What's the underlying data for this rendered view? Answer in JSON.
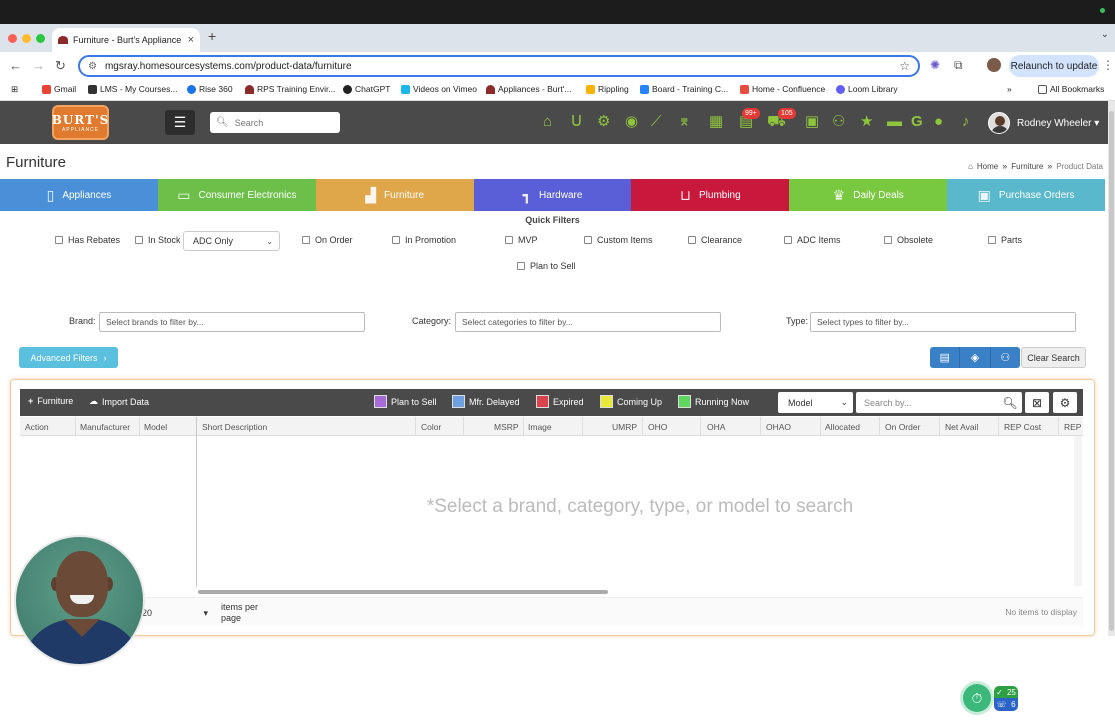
{
  "browser": {
    "tab_title": "Furniture - Burt's Appliance S",
    "new_tab": "+",
    "url": "mgsray.homesourcesystems.com/product-data/furniture",
    "relaunch": "Relaunch to update",
    "bookmarks": [
      {
        "label": "Gmail",
        "color": "#ea4335"
      },
      {
        "label": "LMS - My Courses...",
        "color": "#333333"
      },
      {
        "label": "Rise 360",
        "color": "#1a73e8"
      },
      {
        "label": "RPS Training Envir...",
        "color": "#8a2a2a"
      },
      {
        "label": "ChatGPT",
        "color": "#222222"
      },
      {
        "label": "Videos on Vimeo",
        "color": "#1ab7ea"
      },
      {
        "label": "Appliances - Burt'...",
        "color": "#8a2a2a"
      },
      {
        "label": "Rippling",
        "color": "#f5b400"
      },
      {
        "label": "Board - Training C...",
        "color": "#2684ff"
      },
      {
        "label": "Home - Confluence",
        "color": "#e84c3d"
      },
      {
        "label": "Loom Library",
        "color": "#625df5"
      }
    ],
    "all_bookmarks": "All Bookmarks"
  },
  "header": {
    "logo_line1": "BURT'S",
    "logo_line2": "APPLIANCE",
    "search_placeholder": "Search",
    "badge_notes": "99+",
    "badge_cart": "105",
    "user_name": "Rodney Wheeler"
  },
  "page": {
    "title": "Furniture",
    "breadcrumb": [
      "Home",
      "Furniture",
      "Product Data"
    ]
  },
  "categories": [
    {
      "label": "Appliances",
      "color": "#4a90d9",
      "icon": "fridge-icon"
    },
    {
      "label": "Consumer Electronics",
      "color": "#6cc04a",
      "icon": "tv-icon"
    },
    {
      "label": "Furniture",
      "color": "#e0a64a",
      "icon": "sofa-icon"
    },
    {
      "label": "Hardware",
      "color": "#5a5fd8",
      "icon": "drill-icon"
    },
    {
      "label": "Plumbing",
      "color": "#c8193c",
      "icon": "toilet-icon"
    },
    {
      "label": "Daily Deals",
      "color": "#78c940",
      "icon": "trophy-icon"
    },
    {
      "label": "Purchase Orders",
      "color": "#5ab8cc",
      "icon": "briefcase-icon"
    }
  ],
  "quick_filters": {
    "title": "Quick Filters",
    "has_rebates": "Has Rebates",
    "in_stock": "In Stock",
    "adc_select": "ADC Only",
    "on_order": "On Order",
    "in_promotion": "In Promotion",
    "mvp": "MVP",
    "custom_items": "Custom Items",
    "clearance": "Clearance",
    "adc_items": "ADC Items",
    "obsolete": "Obsolete",
    "parts": "Parts",
    "plan_to_sell": "Plan to Sell"
  },
  "filters": {
    "brand_label": "Brand:",
    "brand_placeholder": "Select brands to filter by...",
    "category_label": "Category:",
    "category_placeholder": "Select categories to filter by...",
    "type_label": "Type:",
    "type_placeholder": "Select types to filter by...",
    "advanced": "Advanced Filters",
    "clear": "Clear Search"
  },
  "grid": {
    "add_label": "Furniture",
    "import_label": "Import Data",
    "legend": [
      {
        "label": "Plan to Sell",
        "color": "#a66bd6"
      },
      {
        "label": "Mfr. Delayed",
        "color": "#6fa0e0"
      },
      {
        "label": "Expired",
        "color": "#d9434d"
      },
      {
        "label": "Coming Up",
        "color": "#e8e83a"
      },
      {
        "label": "Running Now",
        "color": "#5fd65f"
      }
    ],
    "search_field": "Model",
    "search_placeholder": "Search by...",
    "columns": [
      "Action",
      "Manufacturer",
      "Model",
      "Short Description",
      "Color",
      "MSRP",
      "Image",
      "UMRP",
      "OHO",
      "OHA",
      "OHAO",
      "Allocated",
      "On Order",
      "Net Avail",
      "REP Cost",
      "REP S"
    ],
    "empty_message": "*Select a brand, category, type, or model to search",
    "page_size": "20",
    "items_per_page": "items per page",
    "no_items": "No items to display"
  },
  "widgets": {
    "count_top": "25",
    "count_bottom": "6"
  }
}
